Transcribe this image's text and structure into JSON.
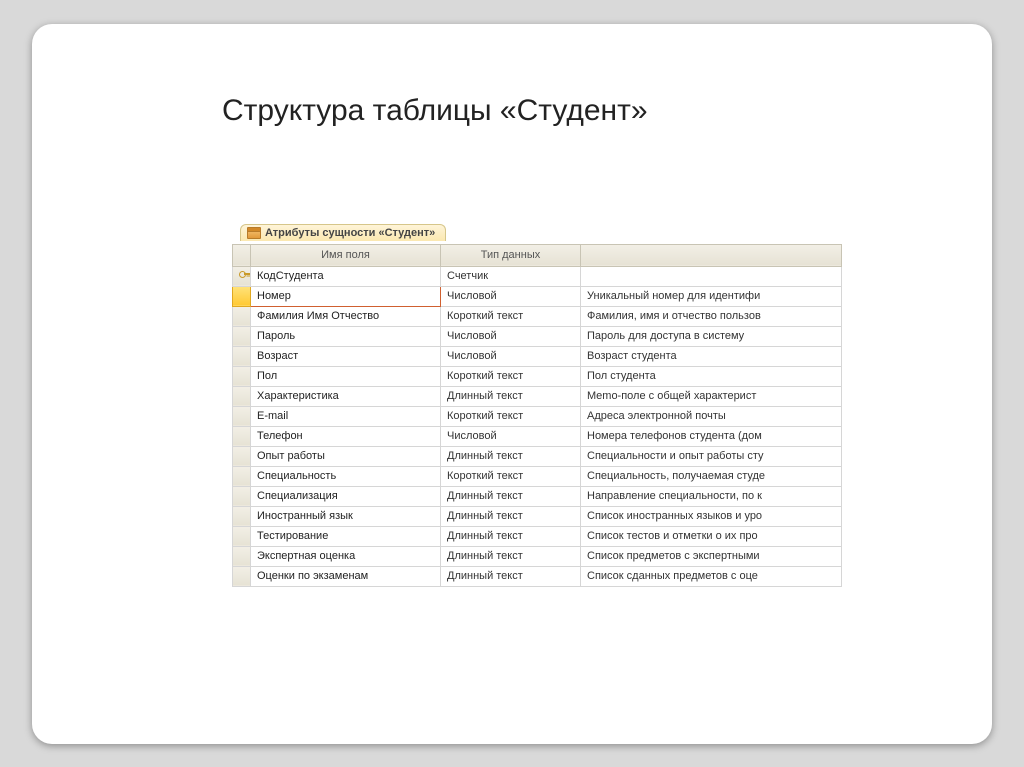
{
  "title": "Структура таблицы «Студент»",
  "tab_label": "Атрибуты сущности «Студент»",
  "headers": {
    "name": "Имя поля",
    "type": "Тип данных",
    "desc": ""
  },
  "rows": [
    {
      "pk": true,
      "selected": false,
      "name": "КодСтудента",
      "type": "Счетчик",
      "desc": ""
    },
    {
      "pk": false,
      "selected": true,
      "name": "Номер",
      "type": "Числовой",
      "desc": "Уникальный номер для идентифи"
    },
    {
      "pk": false,
      "selected": false,
      "name": "Фамилия Имя Отчество",
      "type": "Короткий текст",
      "desc": "Фамилия, имя и отчество пользов"
    },
    {
      "pk": false,
      "selected": false,
      "name": "Пароль",
      "type": "Числовой",
      "desc": "Пароль для доступа в систему"
    },
    {
      "pk": false,
      "selected": false,
      "name": "Возраст",
      "type": "Числовой",
      "desc": "Возраст студента"
    },
    {
      "pk": false,
      "selected": false,
      "name": "Пол",
      "type": "Короткий текст",
      "desc": "Пол студента"
    },
    {
      "pk": false,
      "selected": false,
      "name": "Характеристика",
      "type": "Длинный текст",
      "desc": "Memo-поле с общей характерист"
    },
    {
      "pk": false,
      "selected": false,
      "name": "E-mail",
      "type": "Короткий текст",
      "desc": "Адреса электронной почты"
    },
    {
      "pk": false,
      "selected": false,
      "name": "Телефон",
      "type": "Числовой",
      "desc": "Номера телефонов студента (дом"
    },
    {
      "pk": false,
      "selected": false,
      "name": "Опыт работы",
      "type": "Длинный текст",
      "desc": "Специальности и опыт работы сту"
    },
    {
      "pk": false,
      "selected": false,
      "name": "Специальность",
      "type": "Короткий текст",
      "desc": "Специальность, получаемая студе"
    },
    {
      "pk": false,
      "selected": false,
      "name": "Специализация",
      "type": "Длинный текст",
      "desc": "Направление специальности, по к"
    },
    {
      "pk": false,
      "selected": false,
      "name": "Иностранный язык",
      "type": "Длинный текст",
      "desc": "Список иностранных языков и уро"
    },
    {
      "pk": false,
      "selected": false,
      "name": "Тестирование",
      "type": "Длинный текст",
      "desc": "Список тестов и отметки о их про"
    },
    {
      "pk": false,
      "selected": false,
      "name": "Экспертная оценка",
      "type": "Длинный текст",
      "desc": "Список предметов с экспертными"
    },
    {
      "pk": false,
      "selected": false,
      "name": "Оценки по экзаменам",
      "type": "Длинный текст",
      "desc": "Список сданных предметов с оце"
    }
  ]
}
